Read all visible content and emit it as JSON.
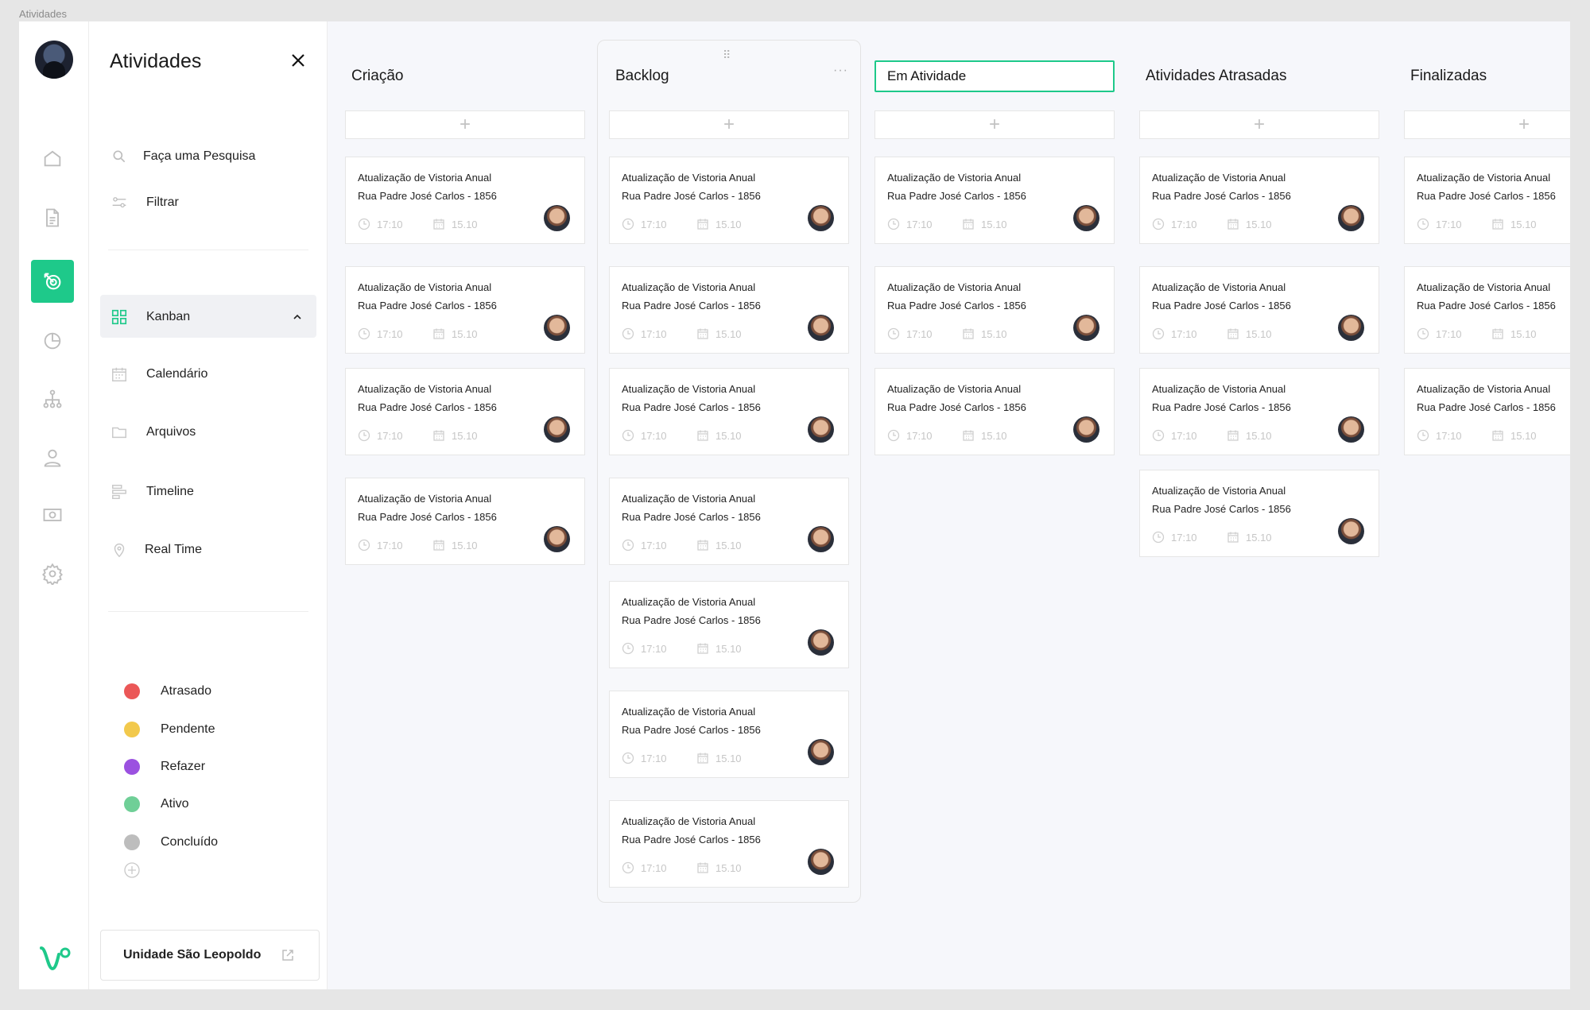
{
  "window_title": "Atividades",
  "panel": {
    "title": "Atividades",
    "search_label": "Faça uma Pesquisa",
    "filter_label": "Filtrar",
    "views": [
      {
        "label": "Kanban",
        "icon": "kanban-icon",
        "active": true
      },
      {
        "label": "Calendário",
        "icon": "calendar-icon"
      },
      {
        "label": "Arquivos",
        "icon": "folder-icon"
      },
      {
        "label": "Timeline",
        "icon": "timeline-icon"
      },
      {
        "label": "Real Time",
        "icon": "location-pin-icon"
      }
    ],
    "statuses": [
      {
        "label": "Atrasado",
        "color": "#eb5757"
      },
      {
        "label": "Pendente",
        "color": "#f2c94c"
      },
      {
        "label": "Refazer",
        "color": "#9b51e0"
      },
      {
        "label": "Ativo",
        "color": "#6fcf97"
      },
      {
        "label": "Concluído",
        "color": "#bdbdbd"
      }
    ],
    "unit_label": "Unidade São Leopoldo"
  },
  "rail": {
    "items": [
      "home-icon",
      "document-icon",
      "activities-icon",
      "chart-icon",
      "org-icon",
      "user-icon",
      "money-icon",
      "settings-icon"
    ],
    "active_index": 2
  },
  "accent": "#1ec98a",
  "card": {
    "title": "Atualização de Vistoria Anual",
    "address": "Rua Padre José Carlos - 1856",
    "time": "17:10",
    "date": "15.10"
  },
  "columns": [
    {
      "title": "Criação",
      "cards": 4
    },
    {
      "title": "Backlog",
      "cards": 7,
      "highlighted": true
    },
    {
      "title": "Em Atividade",
      "cards": 3,
      "editing": true
    },
    {
      "title": "Atividades Atrasadas",
      "cards": 4
    },
    {
      "title": "Finalizadas",
      "cards": 3
    }
  ]
}
